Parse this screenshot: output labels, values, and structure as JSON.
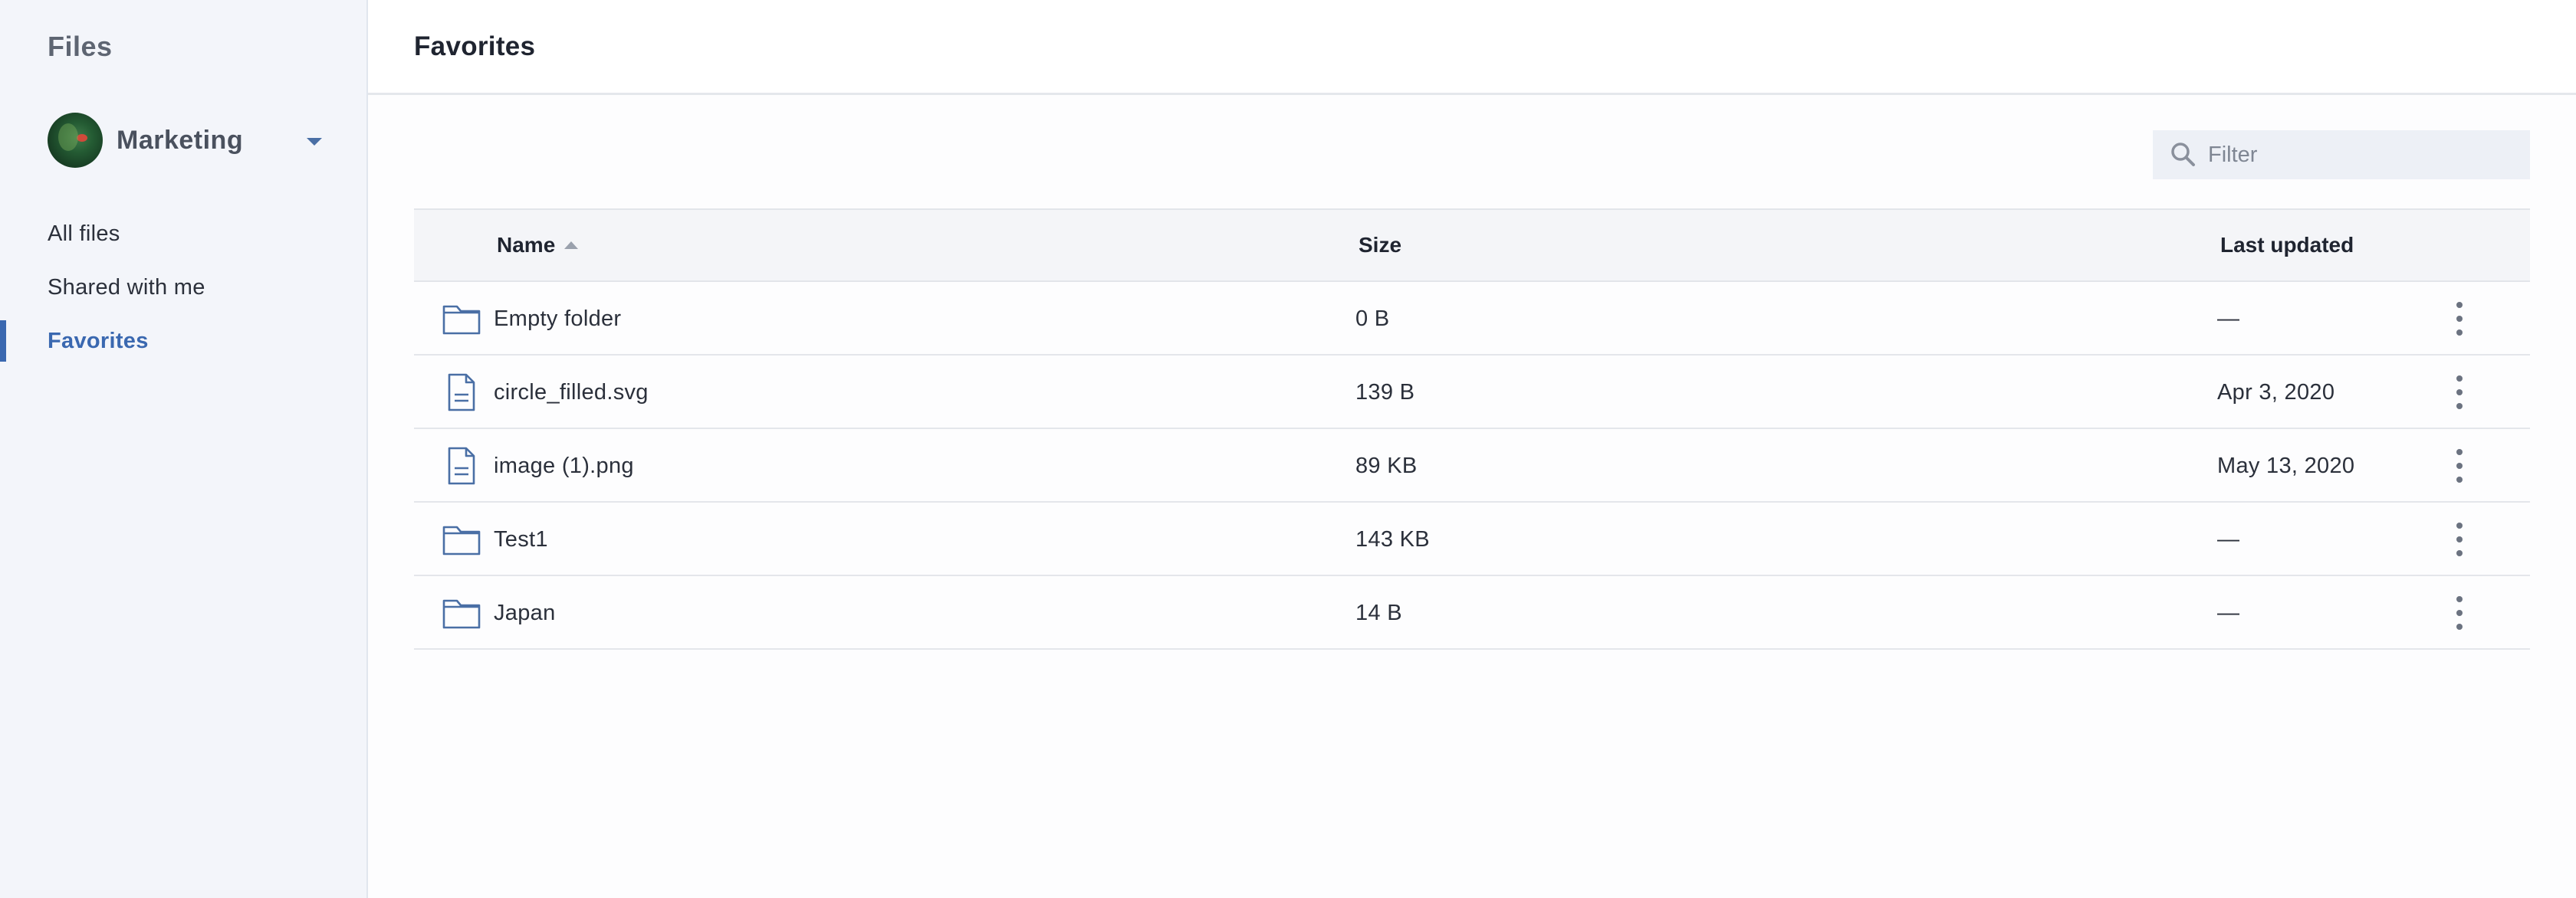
{
  "sidebar": {
    "title": "Files",
    "workspace": {
      "name": "Marketing"
    },
    "nav": [
      {
        "label": "All files",
        "active": false
      },
      {
        "label": "Shared with me",
        "active": false
      },
      {
        "label": "Favorites",
        "active": true
      }
    ]
  },
  "header": {
    "title": "Favorites"
  },
  "filter": {
    "placeholder": "Filter",
    "value": ""
  },
  "table": {
    "columns": {
      "name": "Name",
      "size": "Size",
      "last_updated": "Last updated"
    },
    "sort": {
      "column": "Name",
      "direction": "ascending"
    },
    "rows": [
      {
        "icon": "folder-icon",
        "name": "Empty folder",
        "size": "0 B",
        "updated": "—"
      },
      {
        "icon": "document-icon",
        "name": "circle_filled.svg",
        "size": "139 B",
        "updated": "Apr 3, 2020"
      },
      {
        "icon": "document-icon",
        "name": "image (1).png",
        "size": "89 KB",
        "updated": "May 13, 2020"
      },
      {
        "icon": "folder-icon",
        "name": "Test1",
        "size": "143 KB",
        "updated": "—"
      },
      {
        "icon": "folder-icon",
        "name": "Japan",
        "size": "14 B",
        "updated": "—"
      }
    ]
  },
  "colors": {
    "accent": "#3a68b0",
    "sidebar_bg": "#f3f5fa",
    "table_header_bg": "#f4f5f8",
    "filter_bg": "#edf0f6"
  }
}
